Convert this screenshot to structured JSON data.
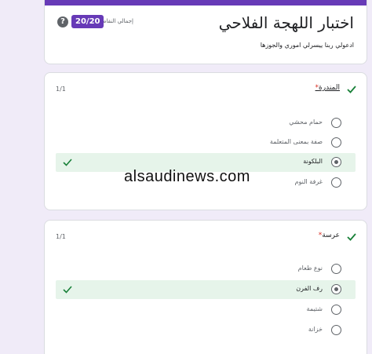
{
  "form": {
    "title": "اختبار اللهجة الفلاحي",
    "description": "ادعولي ربنا ييسرلي اموري والجوزها",
    "score_badge": "20/20",
    "score_label": "إجمالي النقاط",
    "accent_color": "#673ab7"
  },
  "questions": [
    {
      "title": "المندرة",
      "required_mark": "*",
      "score": "1/1",
      "options": [
        {
          "label": "حمام محشي",
          "selected": false,
          "correct": false
        },
        {
          "label": "صفة بمعنى المتعلمة",
          "selected": false,
          "correct": false
        },
        {
          "label": "البلكونة",
          "selected": true,
          "correct": true
        },
        {
          "label": "غرفة النوم",
          "selected": false,
          "correct": false
        }
      ]
    },
    {
      "title": "عرسة",
      "required_mark": "*",
      "score": "1/1",
      "options": [
        {
          "label": "نوع طعام",
          "selected": false,
          "correct": false
        },
        {
          "label": "رف الفرن",
          "selected": true,
          "correct": true
        },
        {
          "label": "شتيمة",
          "selected": false,
          "correct": false
        },
        {
          "label": "خزانة",
          "selected": false,
          "correct": false
        }
      ]
    }
  ],
  "watermark": "alsaudinews.com",
  "colors": {
    "correct_bg": "#e6f4ea",
    "correct_check": "#188038",
    "required": "#d93025"
  }
}
